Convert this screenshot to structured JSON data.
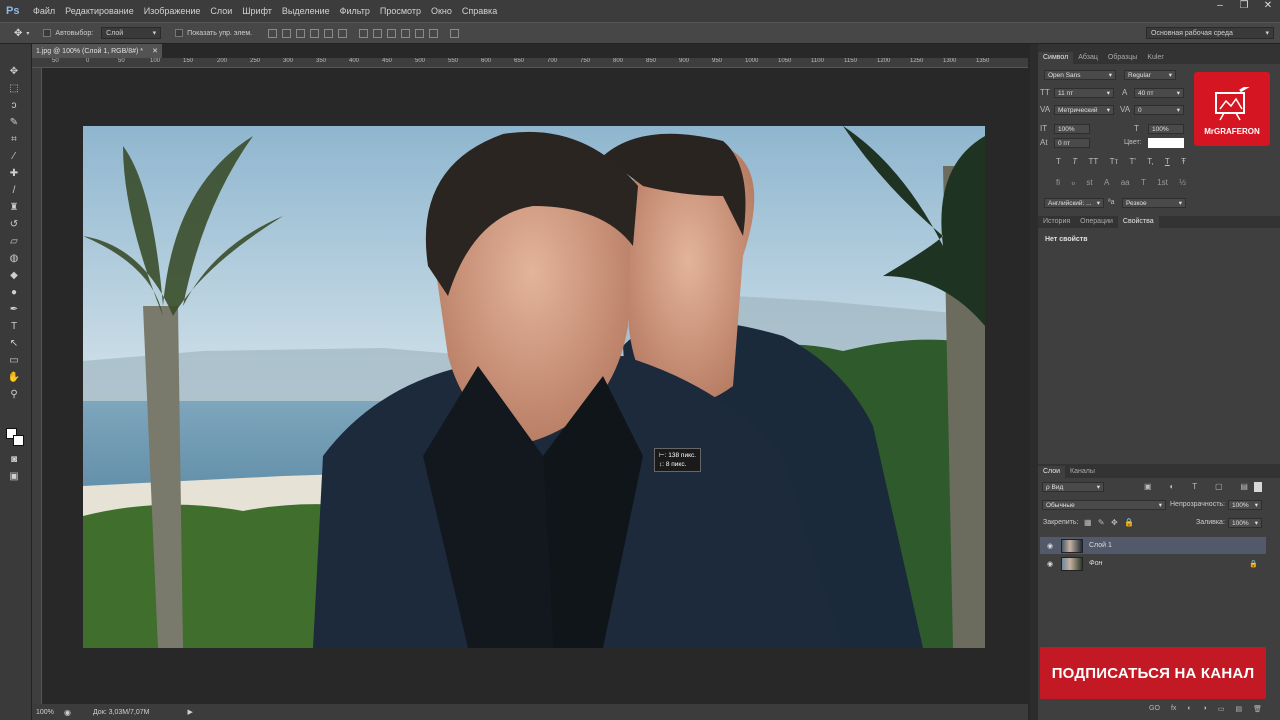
{
  "menubar": {
    "logo": "Ps",
    "items": [
      "Файл",
      "Редактирование",
      "Изображение",
      "Слои",
      "Шрифт",
      "Выделение",
      "Фильтр",
      "Просмотр",
      "Окно",
      "Справка"
    ],
    "window_buttons": [
      "–",
      "❐",
      "✕"
    ]
  },
  "options": {
    "auto_select_label": "Автовыбор:",
    "auto_select_value": "Слой",
    "show_controls_label": "Показать упр. элем.",
    "workspace": "Основная рабочая среда"
  },
  "document": {
    "tab_label": "1.jpg @ 100% (Слой 1, RGB/8#) *",
    "close": "✕",
    "ruler_ticks": [
      "50",
      "0",
      "50",
      "100",
      "150",
      "200",
      "250",
      "300",
      "350",
      "400",
      "450",
      "500",
      "550",
      "600",
      "650",
      "700",
      "750",
      "800",
      "850",
      "900",
      "950",
      "1000",
      "1050",
      "1100",
      "1150",
      "1200",
      "1250",
      "1300",
      "1350"
    ],
    "move_tooltip_x": "⊢: 138 пикс.",
    "move_tooltip_y": "↕: 8 пикс."
  },
  "status": {
    "zoom": "100%",
    "doc_size": "Док: 3,03M/7,07M"
  },
  "character_panel": {
    "tabs": [
      "Символ",
      "Абзац",
      "Образцы",
      "Kuler"
    ],
    "font_family": "Open Sans",
    "font_style": "Regular",
    "font_size": "11 пт",
    "leading": "40 пт",
    "kerning": "Метрический",
    "tracking": "0",
    "vertical_scale": "100%",
    "horizontal_scale": "100%",
    "baseline": "0 пт",
    "color_label": "Цвет:",
    "language": "Английский: ...",
    "aa_label": "ªa",
    "antialias": "Резкое",
    "style_glyphs": [
      "T",
      "T",
      "TT",
      "Tт",
      "T'",
      "T,",
      "T",
      "Ŧ"
    ],
    "otf_glyphs": [
      "fi",
      "ℴ",
      "st",
      "A",
      "aa",
      "T",
      "1st",
      "½"
    ]
  },
  "properties_panel": {
    "tabs": [
      "История",
      "Операции",
      "Свойства"
    ],
    "message": "Нет свойств"
  },
  "layers_panel": {
    "tabs": [
      "Слои",
      "Каналы"
    ],
    "filter": "ρ Вид",
    "blend_mode": "Обычные",
    "opacity_label": "Непрозрачность:",
    "opacity": "100%",
    "lock_label": "Закрепить:",
    "fill_label": "Заливка:",
    "fill": "100%",
    "layers": [
      {
        "name": "Слой 1",
        "selected": true
      },
      {
        "name": "Фон",
        "selected": false
      }
    ],
    "bottom_icons": [
      "GO",
      "fx",
      "◐",
      "◑",
      "▭",
      "▤",
      "🗑"
    ]
  },
  "overlay": {
    "logo_text": "MrGRAFERON",
    "subscribe_text": "ПОДПИСАТЬСЯ НА КАНАЛ"
  },
  "colors": {
    "accent_red": "#d51522",
    "subscribe_red": "#c31924",
    "app_bg": "#282828"
  }
}
